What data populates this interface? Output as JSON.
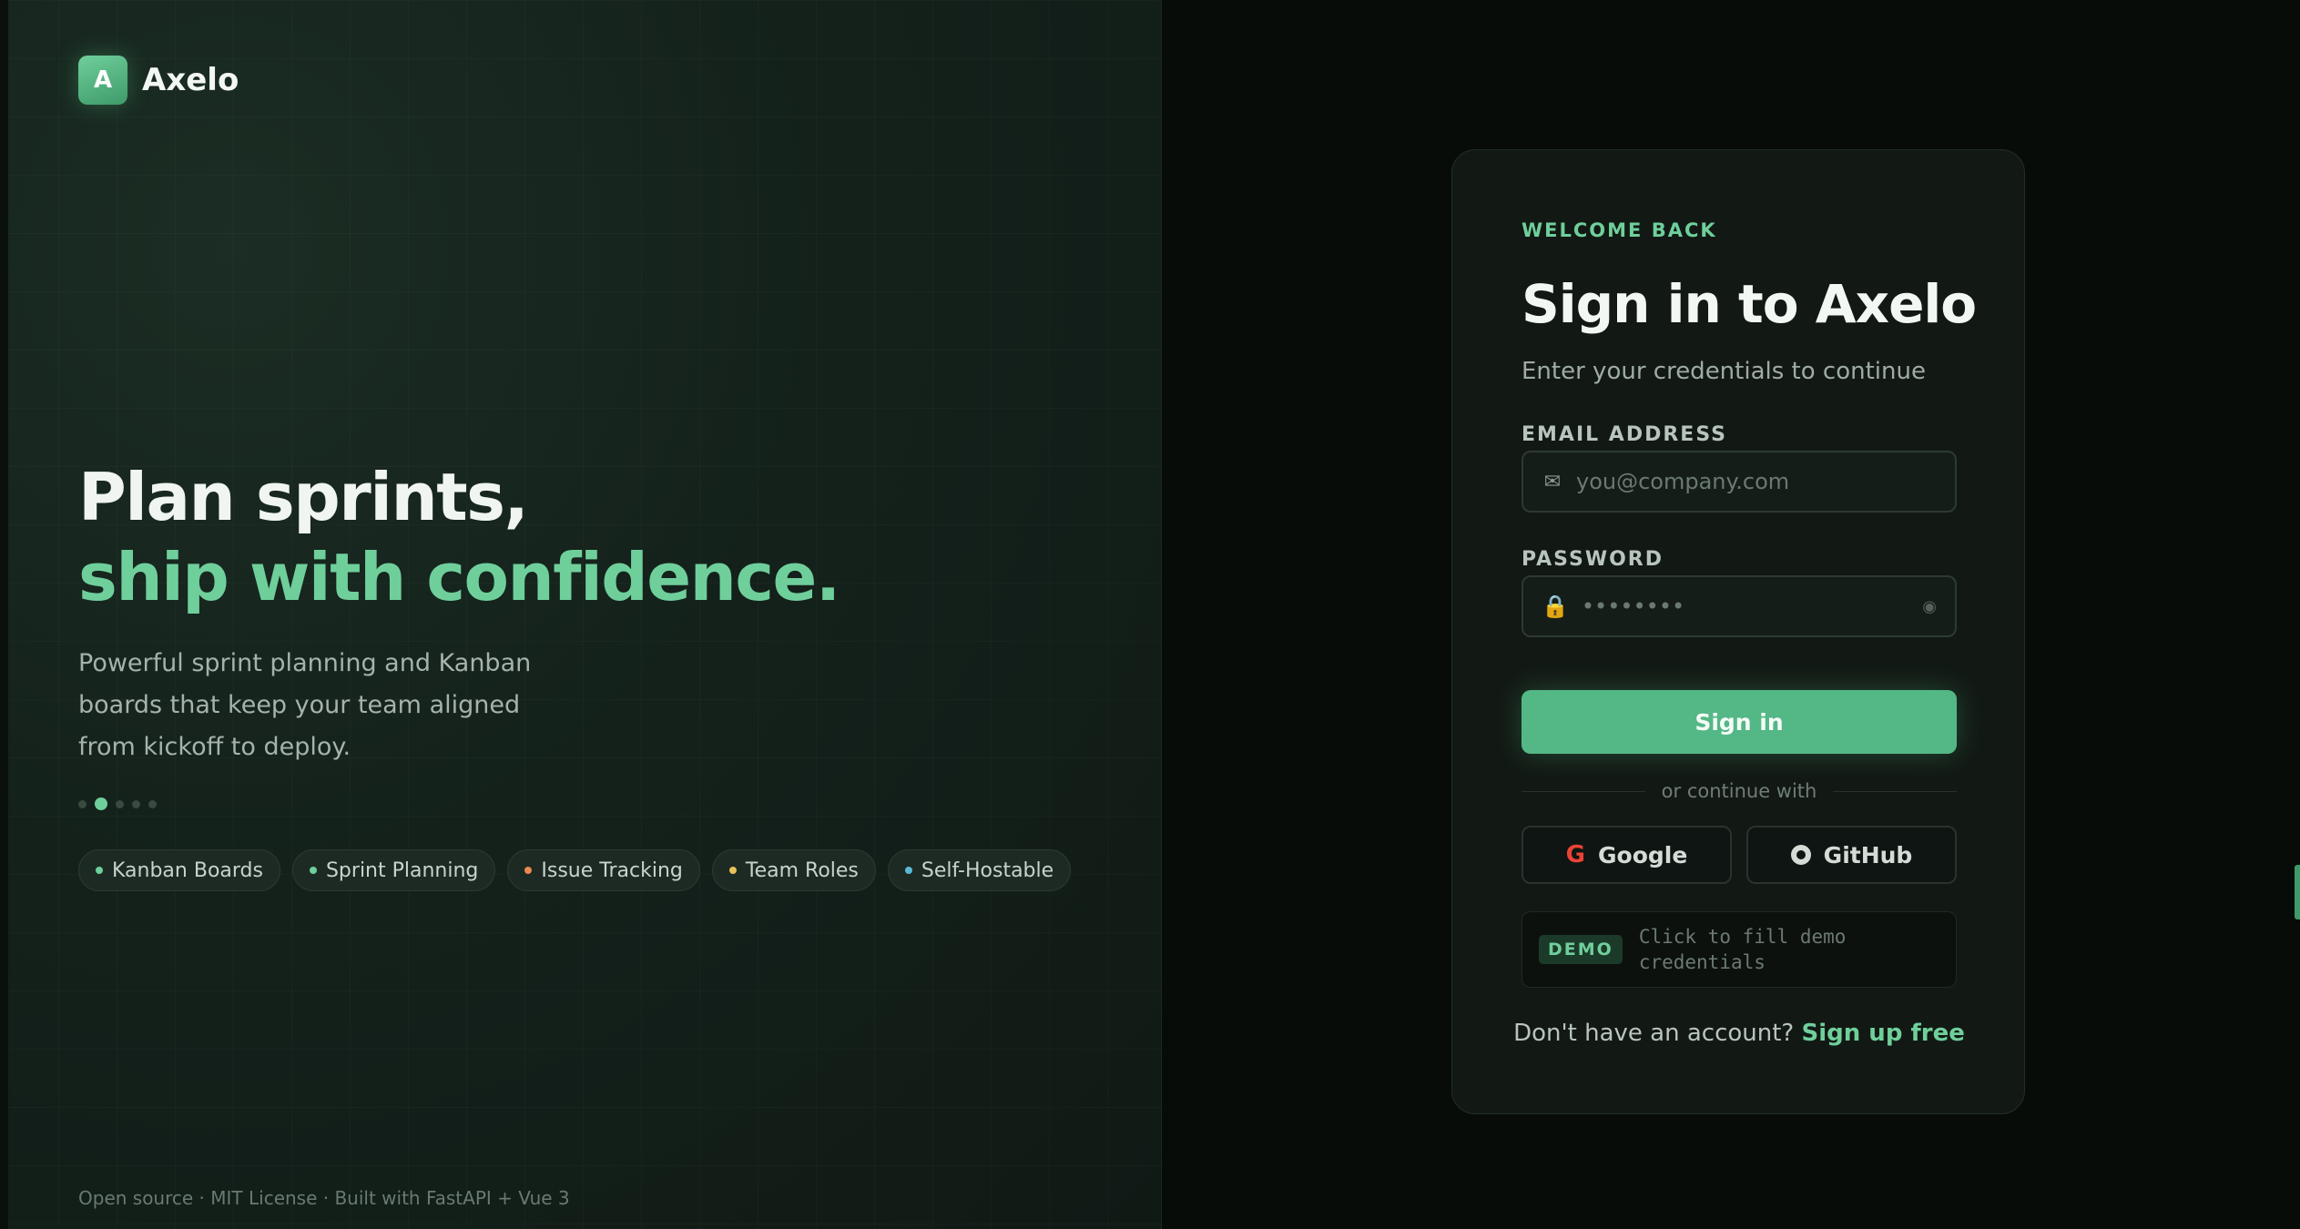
{
  "brand": {
    "logo_letter": "A",
    "name": "Axelo"
  },
  "hero": {
    "line1": "Plan sprints,",
    "line2": "ship with confidence.",
    "description": "Powerful sprint planning and Kanban boards that keep your team aligned from kickoff to deploy.",
    "carousel_active_index": 1,
    "carousel_count": 5
  },
  "features": [
    {
      "label": "Kanban Boards",
      "color": "#6fcf9b"
    },
    {
      "label": "Sprint Planning",
      "color": "#6fcf9b"
    },
    {
      "label": "Issue Tracking",
      "color": "#e8894f"
    },
    {
      "label": "Team Roles",
      "color": "#e8c15a"
    },
    {
      "label": "Self-Hostable",
      "color": "#5ab8d8"
    }
  ],
  "footer": {
    "text": "Open source · MIT License · Built with FastAPI + Vue 3"
  },
  "login": {
    "eyebrow": "WELCOME BACK",
    "title": "Sign in to Axelo",
    "subtitle": "Enter your credentials to continue",
    "email_label": "EMAIL ADDRESS",
    "email_placeholder": "you@company.com",
    "email_value": "",
    "password_label": "PASSWORD",
    "password_placeholder": "••••••••",
    "password_value": "",
    "signin_label": "Sign in",
    "divider_text": "or continue with",
    "google_label": "Google",
    "github_label": "GitHub",
    "demo_badge": "DEMO",
    "demo_text": "Click to fill demo credentials",
    "signup_prompt": "Don't have an account?",
    "signup_link": "Sign up free"
  },
  "icons": {
    "email": "mail-icon",
    "password": "lock-icon",
    "toggle": "eye-icon",
    "google": "google-icon",
    "github": "github-icon"
  }
}
